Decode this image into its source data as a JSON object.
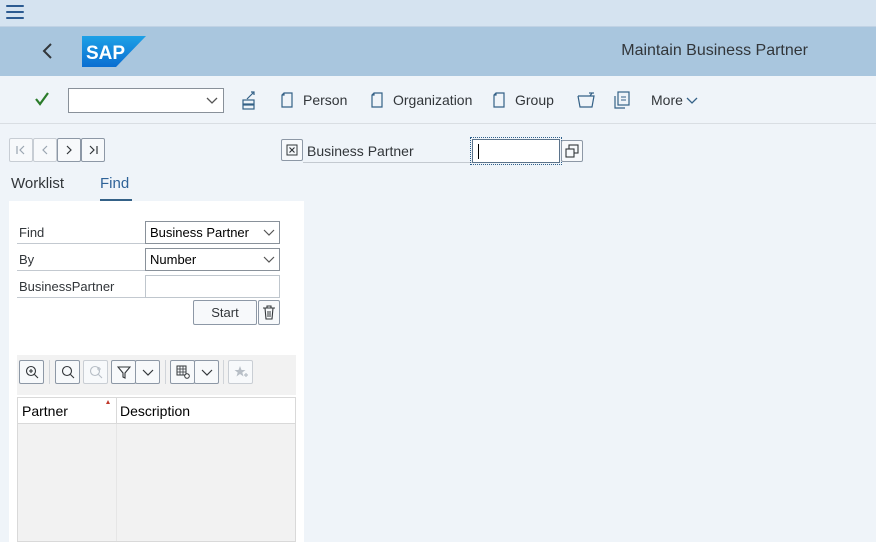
{
  "shell": {
    "title": "Maintain Business Partner",
    "logo_text": "SAP"
  },
  "toolbar": {
    "command_field_value": "",
    "buttons": [
      {
        "label": "Person"
      },
      {
        "label": "Organization"
      },
      {
        "label": "Group"
      }
    ],
    "more_label": "More"
  },
  "header_field": {
    "label": "Business Partner",
    "value": ""
  },
  "tabs": {
    "worklist": "Worklist",
    "find": "Find",
    "active": "Find"
  },
  "find_panel": {
    "find_label": "Find",
    "find_value": "Business Partner",
    "by_label": "By",
    "by_value": "Number",
    "bp_label": "BusinessPartner",
    "bp_value": "",
    "start_label": "Start"
  },
  "result_grid": {
    "columns": [
      "Partner",
      "Description"
    ],
    "rows": []
  },
  "colors": {
    "shell_bar": "#a9c6de",
    "menu_bar": "#d5e3f0",
    "accent": "#2f6398",
    "check_green": "#2b7c2b"
  }
}
